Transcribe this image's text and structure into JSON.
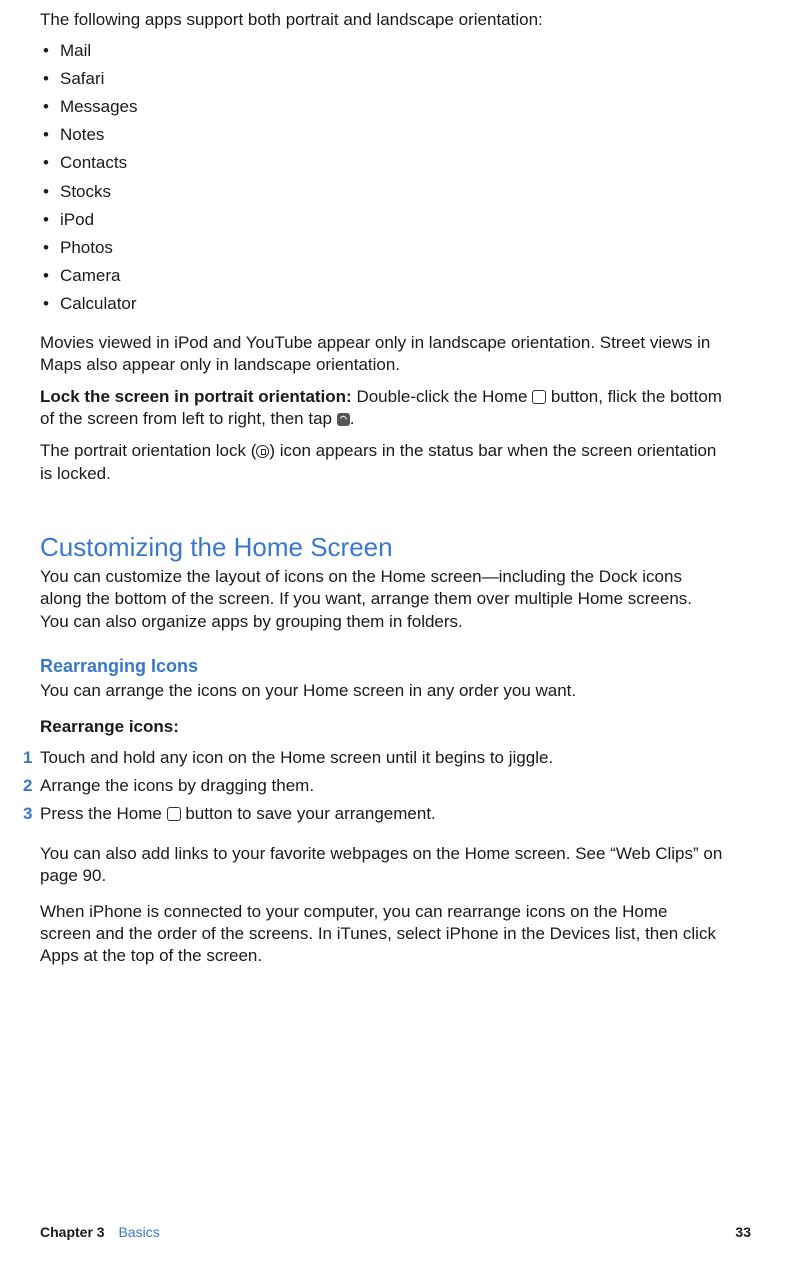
{
  "intro_text": "The following apps support both portrait and landscape orientation:",
  "apps": [
    "Mail",
    "Safari",
    "Messages",
    "Notes",
    "Contacts",
    "Stocks",
    "iPod",
    "Photos",
    "Camera",
    "Calculator"
  ],
  "landscape_note": "Movies viewed in iPod and YouTube appear only in landscape orientation. Street views in Maps also appear only in landscape orientation.",
  "lock_label": "Lock the screen in portrait orientation:",
  "lock_pre": "Double-click the Home ",
  "lock_mid": " button, flick the bottom of the screen from left to right, then tap ",
  "lock_end": ".",
  "status_pre": "The portrait orientation lock (",
  "status_post": ") icon appears in the status bar when the screen orientation is locked.",
  "h2_custom": "Customizing the Home Screen",
  "custom_text": "You can customize the layout of icons on the Home screen—including the Dock icons along the bottom of the screen. If you want, arrange them over multiple Home screens. You can also organize apps by grouping them in folders.",
  "h3_rearranging": "Rearranging Icons",
  "rearranging_text": "You can arrange the icons on your Home screen in any order you want.",
  "rearrange_label": "Rearrange icons:",
  "steps": [
    {
      "n": "1",
      "text": "Touch and hold any icon on the Home screen until it begins to jiggle."
    },
    {
      "n": "2",
      "text": "Arrange the icons by dragging them."
    },
    {
      "n": "3",
      "pre": "Press the Home ",
      "post": " button to save your arrangement."
    }
  ],
  "webclips_text": "You can also add links to your favorite webpages on the Home screen. See “Web Clips” on page 90.",
  "itunes_text": "When iPhone is connected to your computer, you can rearrange icons on the Home screen and the order of the screens. In iTunes, select iPhone in the Devices list, then click Apps at the top of the screen.",
  "footer": {
    "chapter": "Chapter 3",
    "name": "Basics",
    "page": "33"
  }
}
